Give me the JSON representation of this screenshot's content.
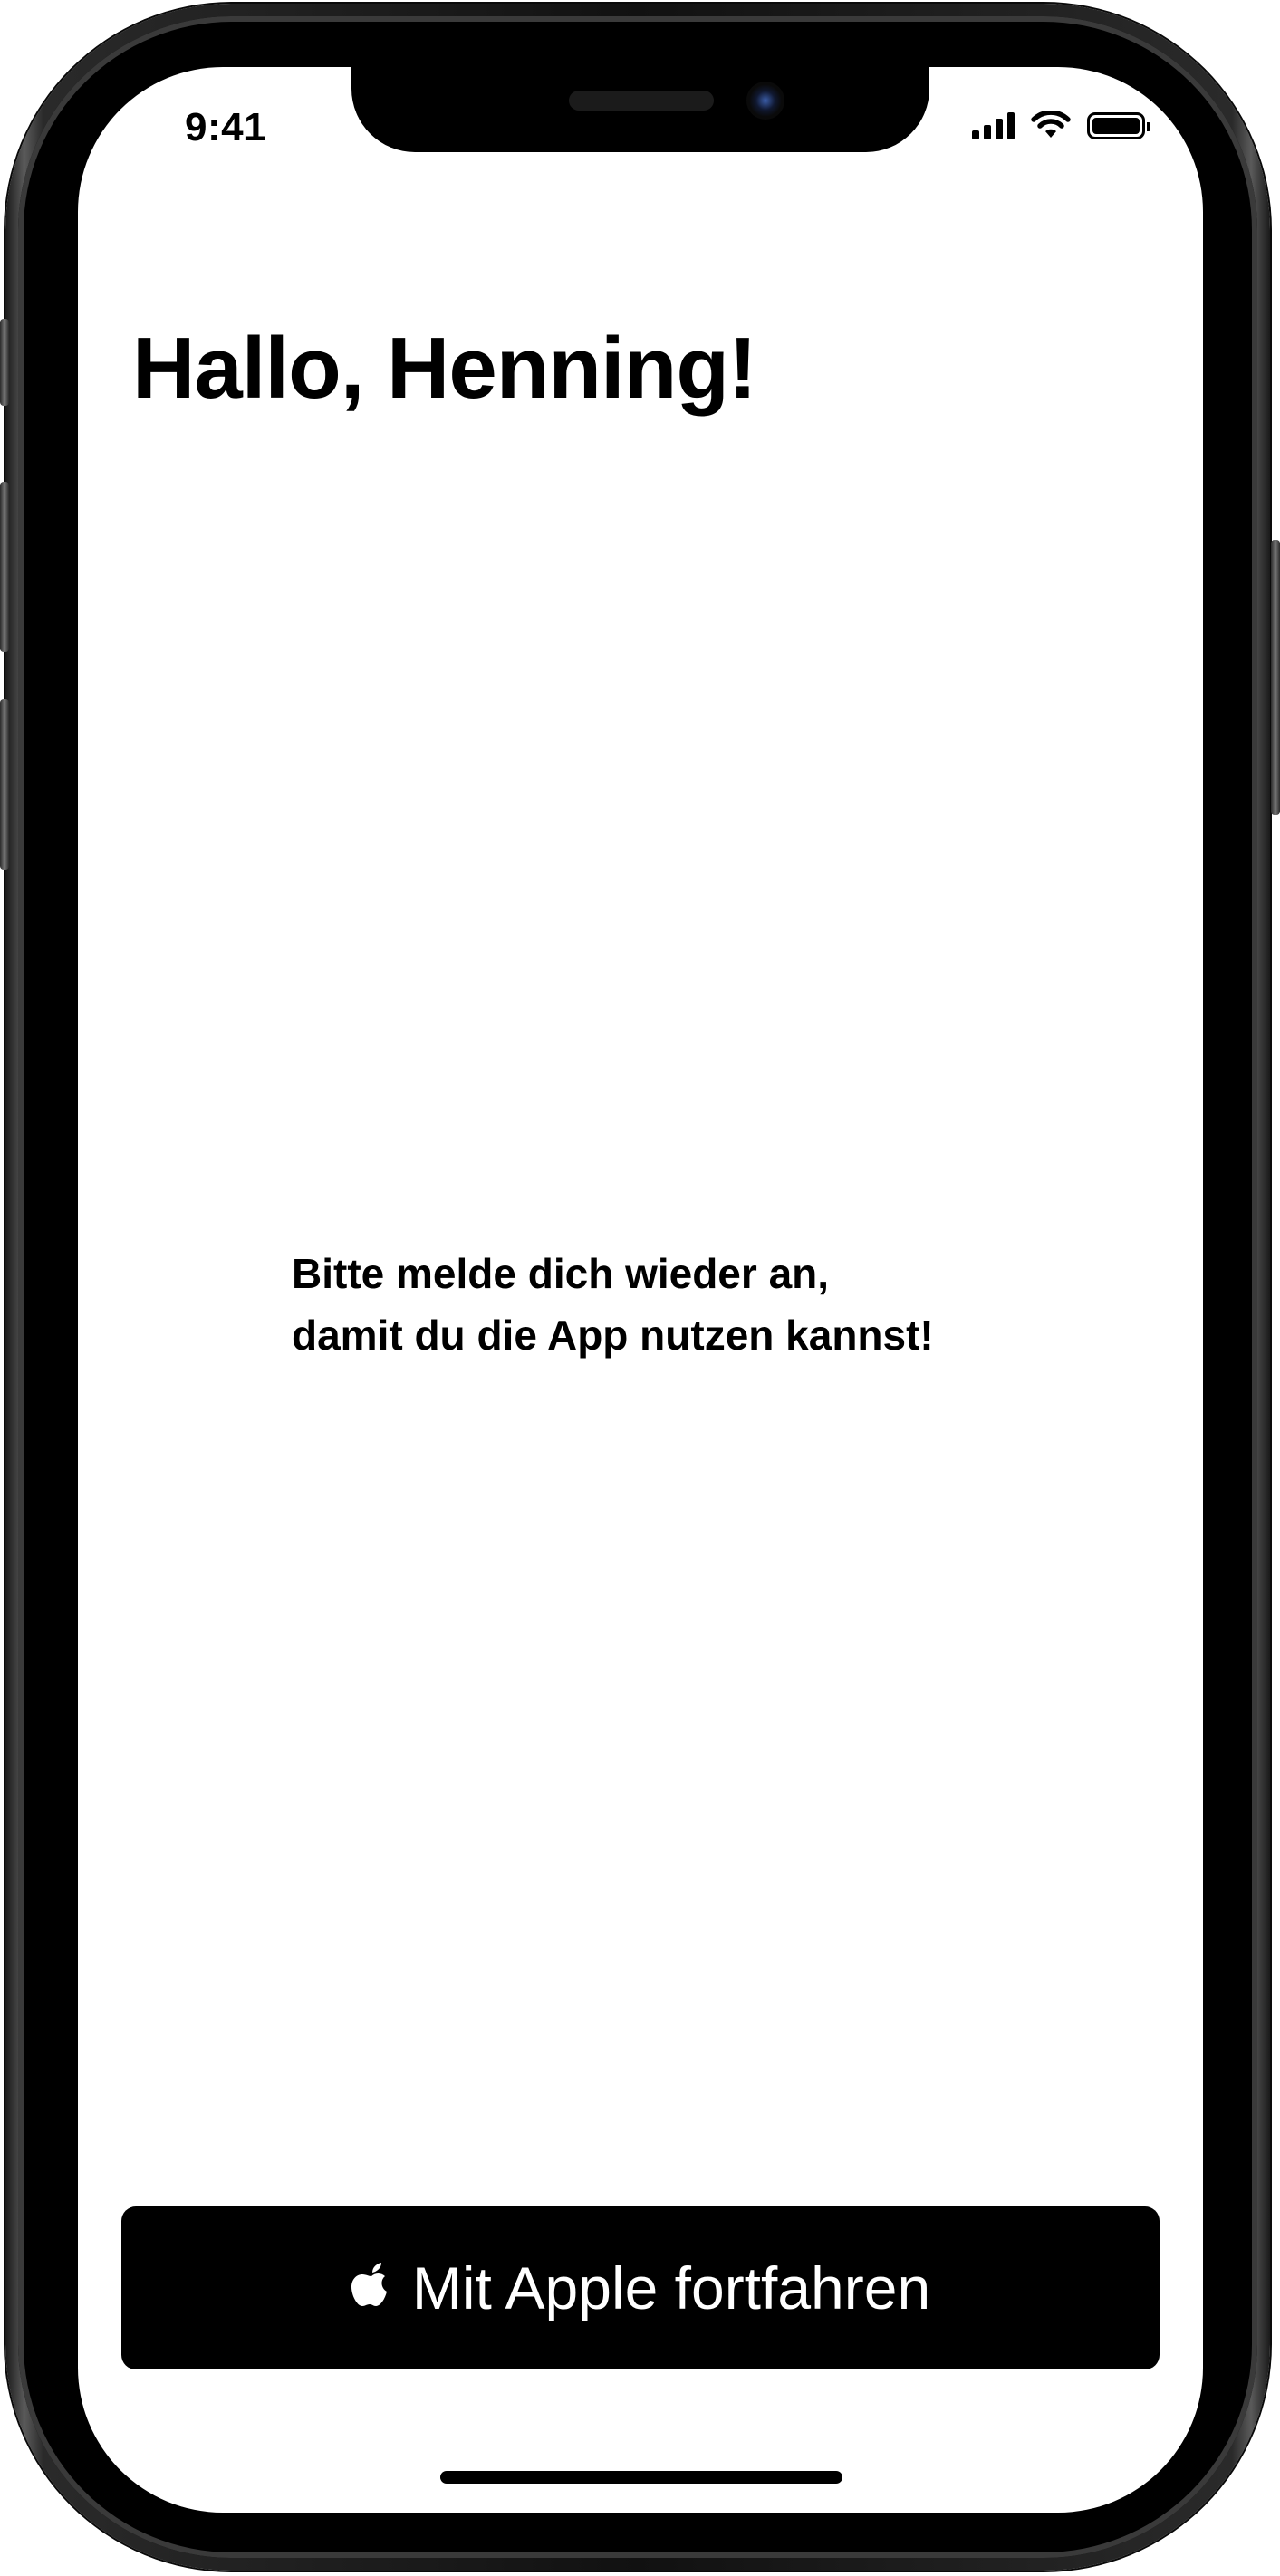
{
  "status_bar": {
    "time": "9:41",
    "icons": [
      "cellular-signal-icon",
      "wifi-icon",
      "battery-icon"
    ]
  },
  "main": {
    "greeting": "Hallo, Henning!",
    "message_lines": [
      "Bitte melde dich wieder an,",
      "damit du die App nutzen kannst!"
    ]
  },
  "sign_in_button": {
    "icon": "apple-logo-icon",
    "label": "Mit Apple fortfahren"
  },
  "colors": {
    "button_background": "#000000",
    "button_text": "#FFFFFF",
    "screen_background": "#FFFFFF",
    "text": "#000000"
  }
}
